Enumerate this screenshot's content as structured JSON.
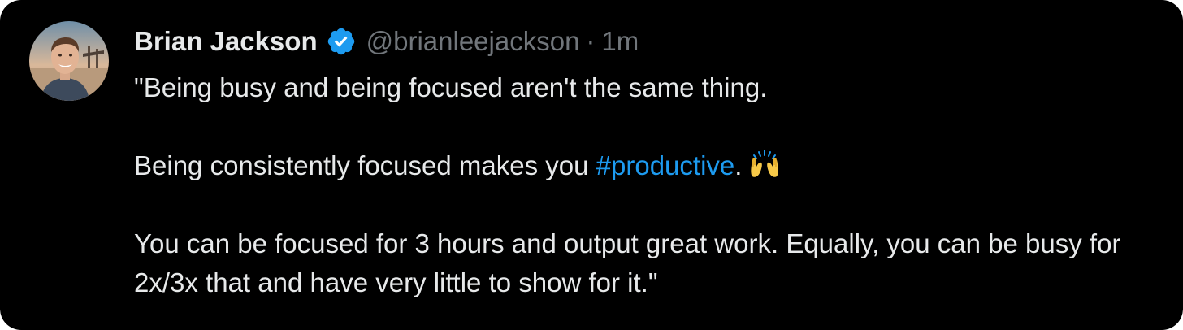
{
  "author": {
    "display_name": "Brian Jackson",
    "handle": "@brianleejackson",
    "separator": "·",
    "timestamp": "1m",
    "verified": true
  },
  "tweet": {
    "line1": "\"Being busy and being focused aren't the same thing.",
    "line2_before": "Being consistently focused makes you ",
    "hashtag": "#productive",
    "line2_after": ".",
    "emoji": "raising-hands-emoji",
    "line3": "You can be focused for 3 hours and output great work. Equally, you can be busy for 2x/3x that and have very little to show for it.\""
  },
  "colors": {
    "background": "#000000",
    "text": "#e7e9ea",
    "muted": "#71767b",
    "accent": "#1d9bf0"
  }
}
